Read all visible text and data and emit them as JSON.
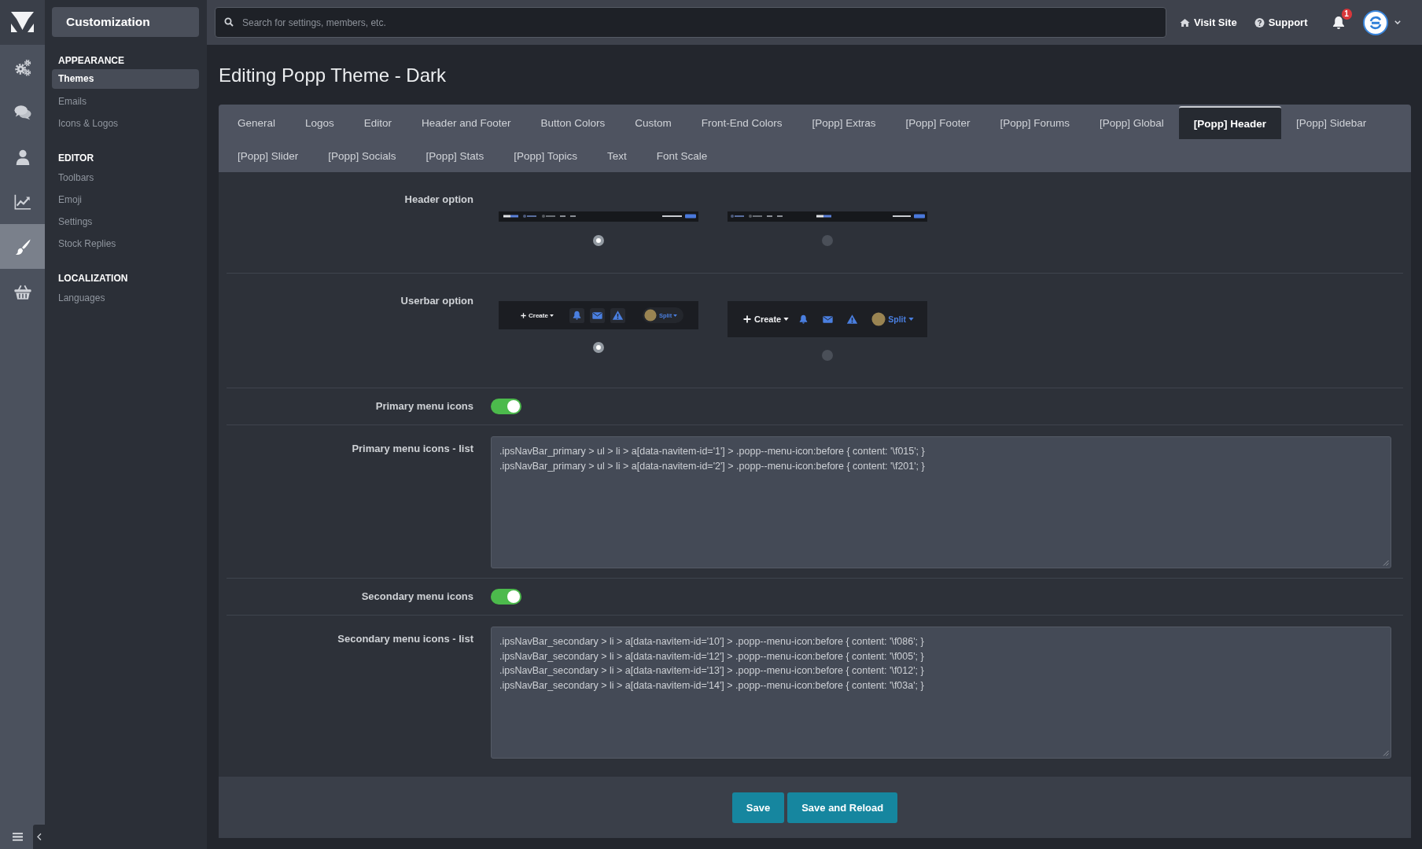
{
  "rail": [
    {
      "selected": false
    },
    {
      "selected": false
    },
    {
      "selected": false
    },
    {
      "selected": false
    },
    {
      "selected": true
    },
    {
      "selected": false
    }
  ],
  "sidebar": {
    "title": "Customization",
    "sections": [
      {
        "heading": "APPEARANCE",
        "items": [
          {
            "label": "Themes",
            "selected": true
          },
          {
            "label": "Emails",
            "selected": false
          },
          {
            "label": "Icons & Logos",
            "selected": false
          }
        ]
      },
      {
        "heading": "EDITOR",
        "items": [
          {
            "label": "Toolbars",
            "selected": false
          },
          {
            "label": "Emoji",
            "selected": false
          },
          {
            "label": "Settings",
            "selected": false
          },
          {
            "label": "Stock Replies",
            "selected": false
          }
        ]
      },
      {
        "heading": "LOCALIZATION",
        "items": [
          {
            "label": "Languages",
            "selected": false
          }
        ]
      }
    ]
  },
  "topbar": {
    "search": {
      "placeholder": "Search for settings, members, etc."
    },
    "links": [
      "Visit Site",
      "Support"
    ],
    "notification_badge": "1"
  },
  "page": {
    "title": "Editing Popp Theme - Dark"
  },
  "tab_rows": [
    [
      {
        "label": "General",
        "selected": false
      },
      {
        "label": "Logos",
        "selected": false
      },
      {
        "label": "Editor",
        "selected": false
      },
      {
        "label": "Header and Footer",
        "selected": false
      },
      {
        "label": "Button Colors",
        "selected": false
      },
      {
        "label": "Custom",
        "selected": false
      },
      {
        "label": "Front-End Colors",
        "selected": false
      },
      {
        "label": "[Popp] Extras",
        "selected": false
      },
      {
        "label": "[Popp] Footer",
        "selected": false
      },
      {
        "label": "[Popp] Forums",
        "selected": false
      },
      {
        "label": "[Popp] Global",
        "selected": false
      },
      {
        "label": "[Popp] Header",
        "selected": true
      },
      {
        "label": "[Popp] Sidebar",
        "selected": false
      }
    ],
    [
      {
        "label": "[Popp] Slider",
        "selected": false
      },
      {
        "label": "[Popp] Socials",
        "selected": false
      },
      {
        "label": "[Popp] Stats",
        "selected": false
      },
      {
        "label": "[Popp] Topics",
        "selected": false
      },
      {
        "label": "Text",
        "selected": false
      },
      {
        "label": "Font Scale",
        "selected": false
      }
    ]
  ],
  "form": {
    "rows": [
      {
        "kind": "header_choice",
        "label": "Header option",
        "options": [
          {
            "kind": "logo_left",
            "selected": true
          },
          {
            "kind": "logo_center",
            "selected": false
          }
        ]
      },
      {
        "kind": "userbar_choice",
        "label": "Userbar option",
        "options": [
          {
            "kind": "compact",
            "selected": true,
            "button": "Create",
            "user": "Split"
          },
          {
            "kind": "spaced",
            "selected": false,
            "button": "Create",
            "user": "Split"
          }
        ]
      },
      {
        "kind": "toggle",
        "label": "Primary menu icons",
        "on": true
      },
      {
        "kind": "textarea",
        "label": "Primary menu icons - list",
        "value": ".ipsNavBar_primary > ul > li > a[data-navitem-id='1'] > .popp--menu-icon:before { content: '\\f015'; }\n.ipsNavBar_primary > ul > li > a[data-navitem-id='2'] > .popp--menu-icon:before { content: '\\f201'; }"
      },
      {
        "kind": "toggle",
        "label": "Secondary menu icons",
        "on": true
      },
      {
        "kind": "textarea",
        "label": "Secondary menu icons - list",
        "value": ".ipsNavBar_secondary > li > a[data-navitem-id='10'] > .popp--menu-icon:before { content: '\\f086'; }\n.ipsNavBar_secondary > li > a[data-navitem-id='12'] > .popp--menu-icon:before { content: '\\f005'; }\n.ipsNavBar_secondary > li > a[data-navitem-id='13'] > .popp--menu-icon:before { content: '\\f012'; }\n.ipsNavBar_secondary > li > a[data-navitem-id='14'] > .popp--menu-icon:before { content: '\\f03a'; }"
      }
    ]
  },
  "footer": {
    "buttons": [
      "Save",
      "Save and Reload"
    ]
  }
}
